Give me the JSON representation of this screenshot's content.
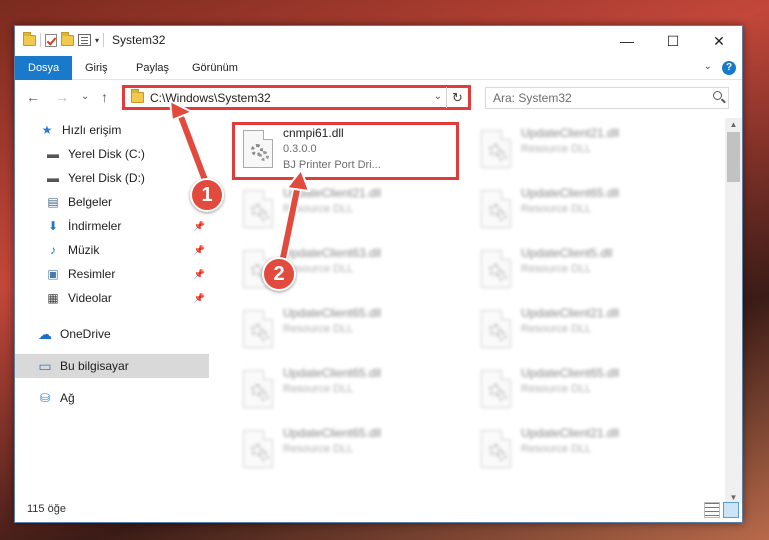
{
  "window": {
    "title": "System32",
    "qat_dropdown_glyph": "▾",
    "controls": {
      "minimize": "—",
      "maximize": "☐",
      "close": "✕"
    }
  },
  "ribbon": {
    "tabs": [
      {
        "label": "Dosya",
        "active": true
      },
      {
        "label": "Giriş"
      },
      {
        "label": "Paylaş"
      },
      {
        "label": "Görünüm"
      }
    ],
    "expand_glyph": "⌄",
    "help_glyph": "?"
  },
  "nav": {
    "back": "←",
    "forward": "→",
    "recent": "⌄",
    "up": "↑",
    "address": "C:\\Windows\\System32",
    "address_dropdown": "⌄",
    "refresh": "↻",
    "search_placeholder": "Ara: System32"
  },
  "sidebar": {
    "items": [
      {
        "label": "Hızlı erişim",
        "icon": "star-icon",
        "glyph": "★",
        "color": "#2a7bd4"
      },
      {
        "label": "Yerel Disk (C:)",
        "icon": "drive-icon",
        "glyph": "▬",
        "color": "#555555"
      },
      {
        "label": "Yerel Disk (D:)",
        "icon": "drive-icon",
        "glyph": "▬",
        "color": "#555555"
      },
      {
        "label": "Belgeler",
        "icon": "document-icon",
        "glyph": "▤",
        "color": "#4a6a8a",
        "pinned": true
      },
      {
        "label": "İndirmeler",
        "icon": "download-icon",
        "glyph": "⬇",
        "color": "#1979ca",
        "pinned": true
      },
      {
        "label": "Müzik",
        "icon": "music-icon",
        "glyph": "♪",
        "color": "#1979ca",
        "pinned": true
      },
      {
        "label": "Resimler",
        "icon": "picture-icon",
        "glyph": "▣",
        "color": "#4a7aa8",
        "pinned": true
      },
      {
        "label": "Videolar",
        "icon": "video-icon",
        "glyph": "▦",
        "color": "#444444",
        "pinned": true
      },
      {
        "label": "OneDrive",
        "icon": "cloud-icon",
        "glyph": "☁",
        "color": "#1b6fc9"
      },
      {
        "label": "Bu bilgisayar",
        "icon": "computer-icon",
        "glyph": "▭",
        "color": "#2a7bd4",
        "selected": true
      },
      {
        "label": "Ağ",
        "icon": "network-icon",
        "glyph": "⛁",
        "color": "#2a7bd4"
      }
    ],
    "pin_glyph": "📌"
  },
  "files": [
    {
      "name": "cnmpi61.dll",
      "version": "0.3.0.0",
      "description": "BJ Printer Port Dri...",
      "highlighted": true
    },
    {
      "name": "UpdateClient21.dll",
      "version": "Resource DLL",
      "blurred": true
    },
    {
      "name": "UpdateClient21.dll",
      "version": "Resource DLL",
      "blurred": true
    },
    {
      "name": "UpdateClient65.dll",
      "version": "Resource DLL",
      "blurred": true
    },
    {
      "name": "UpdateClient63.dll",
      "version": "Resource DLL",
      "blurred": true
    },
    {
      "name": "UpdateClient5.dll",
      "version": "Resource DLL",
      "blurred": true
    },
    {
      "name": "UpdateClient65.dll",
      "version": "Resource DLL",
      "blurred": true
    },
    {
      "name": "UpdateClient21.dll",
      "version": "Resource DLL",
      "blurred": true
    },
    {
      "name": "UpdateClient65.dll",
      "version": "Resource DLL",
      "blurred": true
    },
    {
      "name": "UpdateClient65.dll",
      "version": "Resource DLL",
      "blurred": true
    },
    {
      "name": "UpdateClient65.dll",
      "version": "Resource DLL",
      "blurred": true
    },
    {
      "name": "UpdateClient21.dll",
      "version": "Resource DLL",
      "blurred": true
    }
  ],
  "status": {
    "count": "115 öğe"
  },
  "annotations": {
    "step1": "1",
    "step2": "2",
    "color": "#e14a3c"
  }
}
